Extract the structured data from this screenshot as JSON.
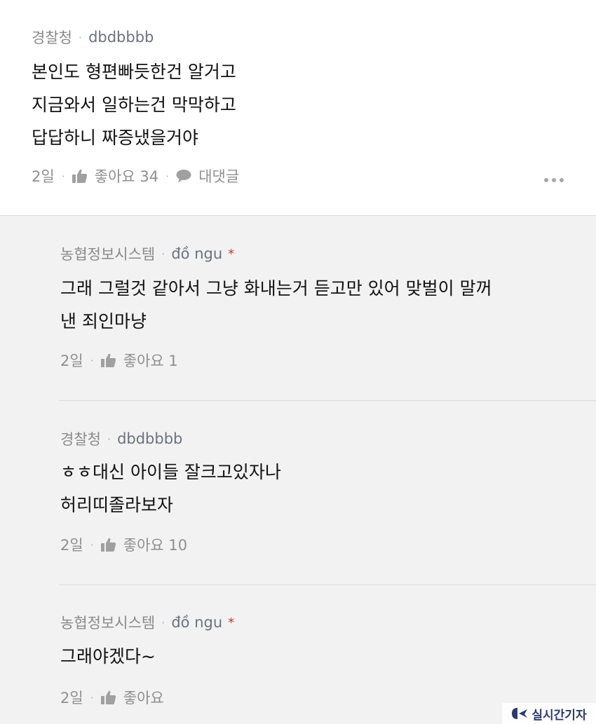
{
  "comments": [
    {
      "company": "경찰청",
      "nickname": "dbdbbbb",
      "lines": [
        "본인도 형편빠듯한건 알거고",
        "지금와서 일하는건 막막하고",
        "답답하니 짜증냈을거야"
      ],
      "time": "2일",
      "like_label": "좋아요 34",
      "reply_label": "대댓글"
    }
  ],
  "replies": [
    {
      "company": "농협정보시스템",
      "nickname": "đồ ngu",
      "star": "*",
      "lines": [
        "그래 그럴것 같아서 그냥 화내는거 듣고만 있어 맞벌이 말꺼",
        "낸 죄인마냥"
      ],
      "time": "2일",
      "like_label": "좋아요 1"
    },
    {
      "company": "경찰청",
      "nickname": "dbdbbbb",
      "lines": [
        "ㅎㅎ대신 아이들 잘크고있자나",
        "허리띠졸라보자"
      ],
      "time": "2일",
      "like_label": "좋아요 10"
    },
    {
      "company": "농협정보시스템",
      "nickname": "đồ ngu",
      "star": "*",
      "lines": [
        "그래야겠다~"
      ],
      "time": "2일",
      "like_label": "좋아요"
    }
  ],
  "separator": "·",
  "icons": {
    "like": "thumbs-up-icon",
    "reply": "speech-bubble-icon",
    "more": "more-dots-icon"
  },
  "watermark": "실시간기자",
  "colors": {
    "page_bg": "#f2f2f2",
    "top_bg": "#ffffff",
    "meta": "#8a8a8a",
    "star": "#d32f2f",
    "watermark": "#2b3a6e"
  }
}
